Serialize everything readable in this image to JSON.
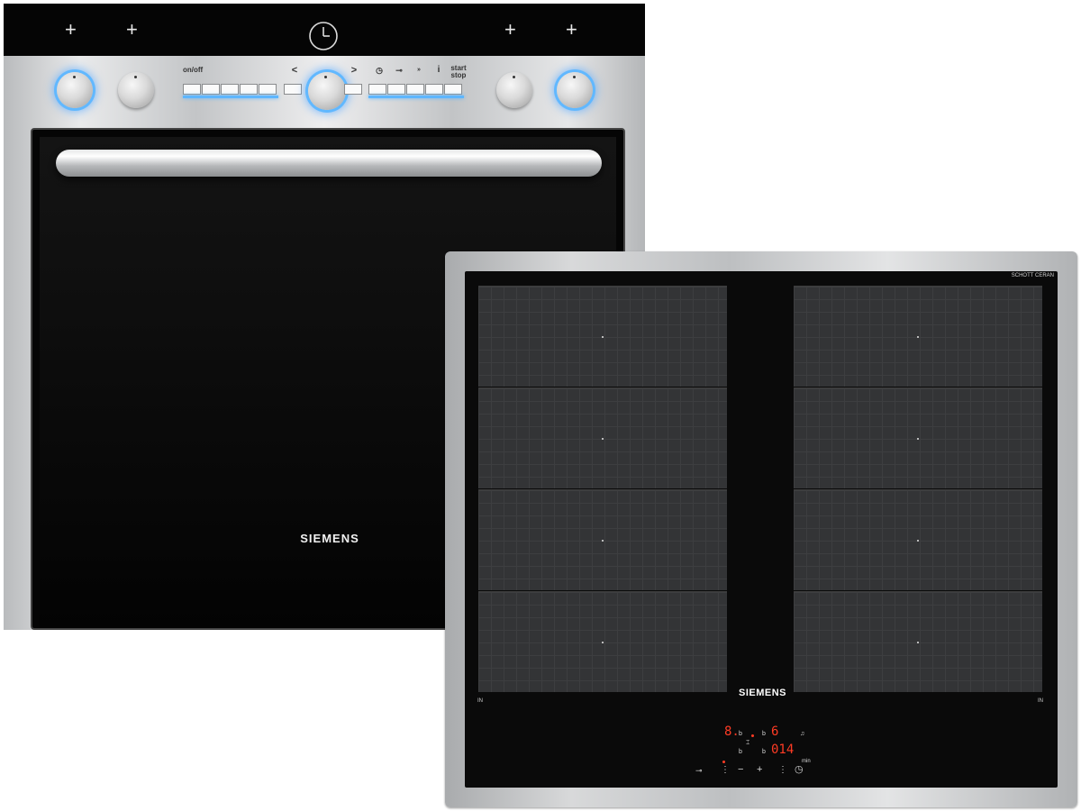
{
  "oven": {
    "brand": "SIEMENS",
    "display_symbols": [
      "+",
      "+",
      "+",
      "+"
    ],
    "clock_icon": "clock-icon",
    "panel_labels": {
      "onoff": "on/off",
      "start_stop": "start stop",
      "info": "i",
      "prev": "<",
      "next": ">"
    },
    "accent_color": "#5db6ff"
  },
  "hob": {
    "brand": "SIEMENS",
    "glass_brand": "SCHOTT CERAN",
    "zone_label_left": "IN",
    "zone_label_right": "IN",
    "display": {
      "left_top": "8.",
      "right_top": "6",
      "right_bottom": "014",
      "b": "b",
      "min": "min"
    },
    "controls": {
      "minus": "−",
      "plus": "+"
    },
    "display_color": "#ff3b24"
  }
}
